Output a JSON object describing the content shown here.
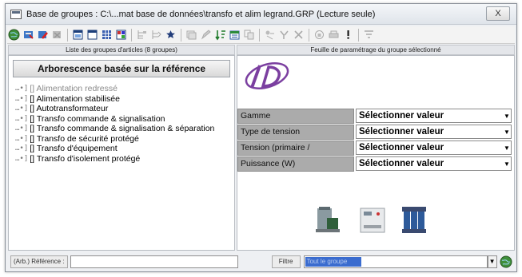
{
  "window": {
    "title": "Base de groupes : C:\\...mat base de données\\transfo et alim legrand.GRP (Lecture seule)",
    "close_label": "X"
  },
  "toolbar": {
    "icons": [
      "globe-icon",
      "db-open-icon",
      "db-edit-icon",
      "db-close-icon",
      "display-icon",
      "window-icon",
      "grid-icon",
      "color-grid-icon",
      "tree-expand-icon",
      "tree-collapse-icon",
      "star-icon",
      "stack-icon",
      "pencil-icon",
      "sort-icon",
      "calendar-icon",
      "copy-icon",
      "move-icon",
      "delete-icon",
      "lock-icon",
      "print-icon",
      "info-icon",
      "filter-icon"
    ]
  },
  "left_panel": {
    "header": "Liste des groupes d'articles (8 groupes)",
    "tree_button": "Arborescence basée sur la référence",
    "tree_prefix": "…•]",
    "items": [
      {
        "label": "[] Alimentation redressé"
      },
      {
        "label": "[] Alimentation stabilisée"
      },
      {
        "label": "[] Autotransformateur"
      },
      {
        "label": "[] Transfo commande & signalisation"
      },
      {
        "label": "[] Transfo commande & signalisation & séparation"
      },
      {
        "label": "[] Transfo de sécurité protégé"
      },
      {
        "label": "[] Transfo d'équipement"
      },
      {
        "label": "[] Transfo d'isolement protégé"
      }
    ]
  },
  "right_panel": {
    "header": "Feuille de paramétrage du groupe sélectionné",
    "params": [
      {
        "label": "Gamme",
        "value": "Sélectionner valeur"
      },
      {
        "label": "Type de tension",
        "value": "Sélectionner valeur"
      },
      {
        "label": "Tension (primaire / secondaire)",
        "value": "Sélectionner valeur"
      },
      {
        "label": "Puissance (W)",
        "value": "Sélectionner valeur"
      }
    ]
  },
  "bottom": {
    "ref_label": "(Arb.) Référence :",
    "ref_value": "",
    "filter_label": "Filtre",
    "filter_value": "Tout le groupe"
  },
  "colors": {
    "param_label_bg": "#ababab",
    "selection_blue": "#3a6ccf",
    "logo_purple": "#7b3fa0"
  }
}
